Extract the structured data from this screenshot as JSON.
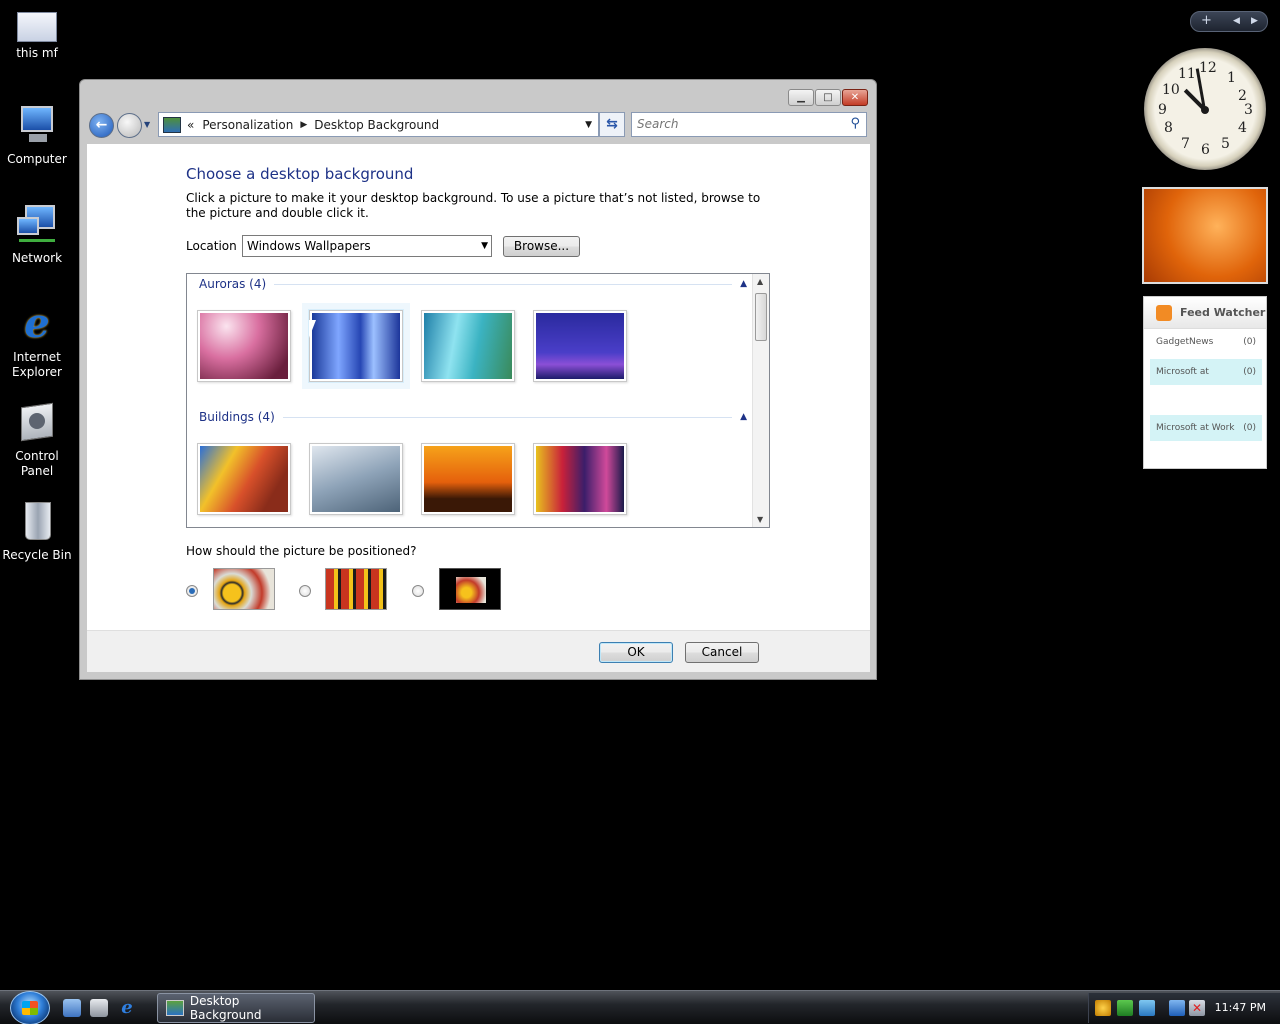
{
  "desktop_icons": [
    {
      "label": "this mf"
    },
    {
      "label": "Computer"
    },
    {
      "label": "Network"
    },
    {
      "label": "Internet Explorer"
    },
    {
      "label": "Control Panel"
    },
    {
      "label": "Recycle Bin"
    }
  ],
  "window": {
    "breadcrumb": {
      "chevrons": "«",
      "part1": "Personalization",
      "part2": "Desktop Background"
    },
    "search": {
      "placeholder": "Search"
    },
    "heading": "Choose a desktop background",
    "description": "Click a picture to make it your desktop background. To use a picture that’s not listed, browse to the picture and double click it.",
    "location_label": "Location",
    "location_value": "Windows Wallpapers",
    "browse_label": "Browse...",
    "groups": [
      {
        "title": "Auroras (4)",
        "images": [
          "aurora-pink",
          "aurora-blue",
          "aurora-teal",
          "aurora-purple"
        ],
        "selected_index": 1
      },
      {
        "title": "Buildings (4)",
        "images": [
          "glass-building",
          "glass-panes",
          "taj-mahal",
          "city-night"
        ]
      }
    ],
    "position_question": "How should the picture be positioned?",
    "position_options": [
      {
        "name": "fit-to-screen",
        "selected": true
      },
      {
        "name": "tile",
        "selected": false
      },
      {
        "name": "center",
        "selected": false
      }
    ],
    "ok_label": "OK",
    "cancel_label": "Cancel"
  },
  "gadgets": {
    "clock_numbers": [
      "12",
      "1",
      "2",
      "3",
      "4",
      "5",
      "6",
      "7",
      "8",
      "9",
      "10",
      "11"
    ],
    "feed_title": "Feed Watcher",
    "feed_items": [
      {
        "name": "GadgetNews",
        "count": "(0)"
      },
      {
        "name": "Microsoft at",
        "count": "(0)"
      },
      {
        "name": "Microsoft at Work",
        "count": "(0)"
      }
    ]
  },
  "taskbar": {
    "task_label": "Desktop Background",
    "time": "11:47 PM"
  },
  "colors": {
    "heading": "#1e3287",
    "accent_blue": "#2a6cb8",
    "desktop": "#000000"
  }
}
